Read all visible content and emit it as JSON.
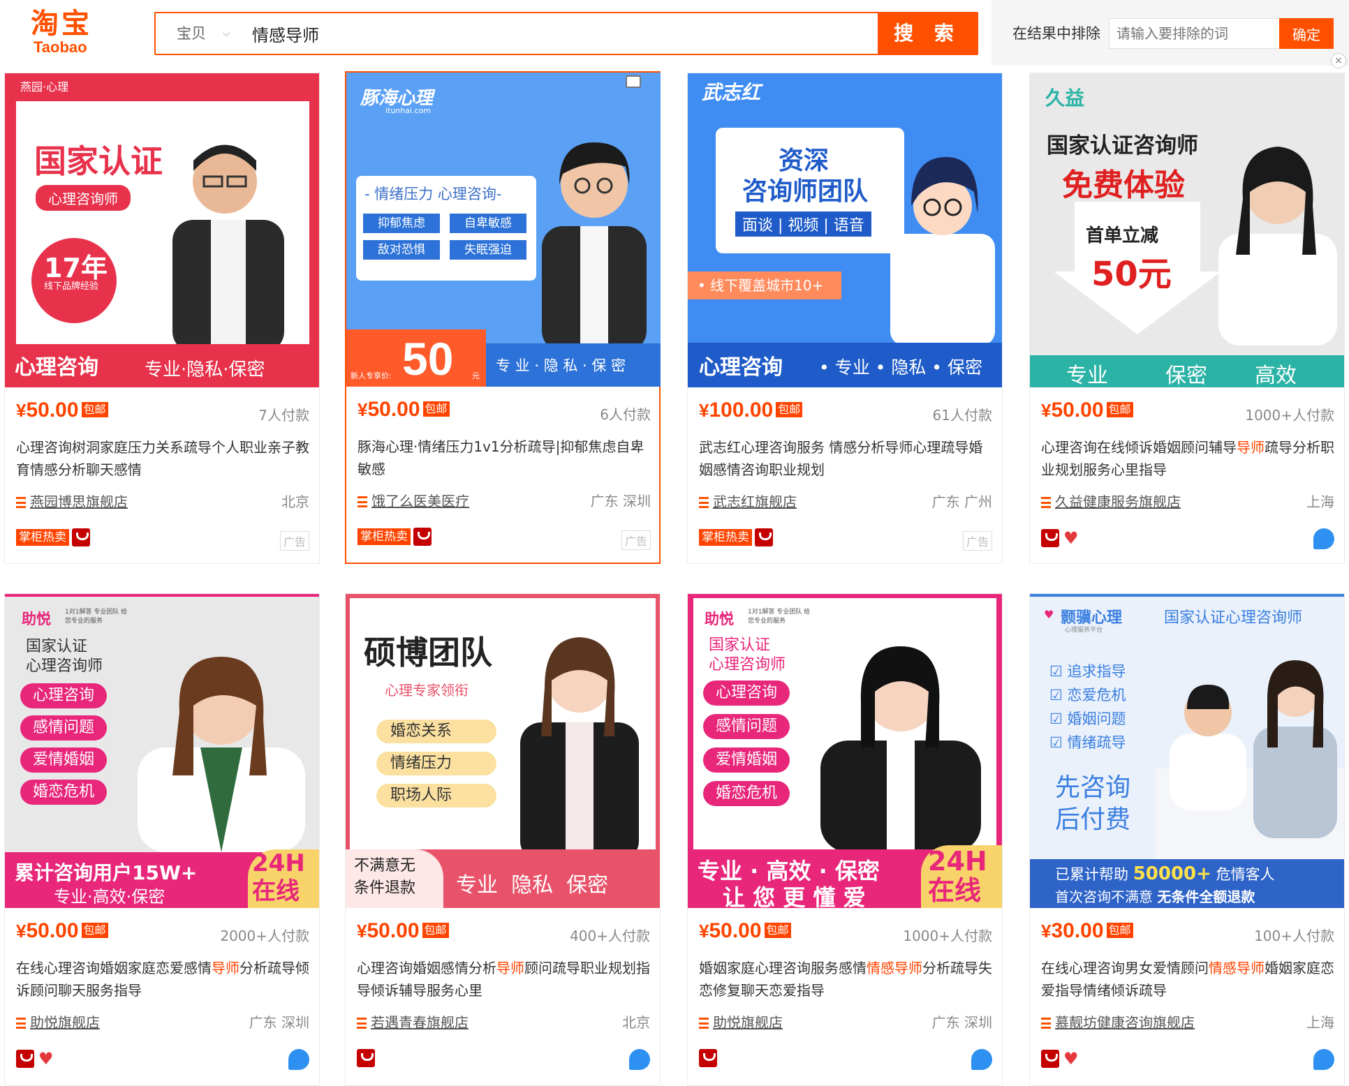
{
  "header": {
    "logo_cn": "淘宝",
    "logo_en": "Taobao",
    "scope": "宝贝",
    "query": "情感导师",
    "search_label": "搜 索",
    "exclude_label": "在结果中排除",
    "exclude_placeholder": "请输入要排除的词",
    "confirm_label": "确定",
    "close_symbol": "×"
  },
  "products": [
    {
      "price": "50.00",
      "baoyou": "包邮",
      "sales": "7人付款",
      "title": "心理咨询树洞家庭压力关系疏导个人职业亲子教育情感分析聊天感情",
      "shop": "燕园博思旗舰店",
      "location": "北京",
      "hot": "掌柜热卖",
      "ad": "广告",
      "img": {
        "brand": "燕园·心理",
        "headline": "国家认证",
        "sub": "心理咨询师",
        "years": "17年",
        "years_note": "线下品牌经验",
        "banner_left": "心理咨询",
        "banner_right": "专业·隐私·保密"
      }
    },
    {
      "price": "50.00",
      "baoyou": "包邮",
      "sales": "6人付款",
      "title": "豚海心理·情绪压力1v1分析疏导|抑郁焦虑自卑敏感",
      "shop": "饿了么医美医疗",
      "location": "广东 深圳",
      "hot": "掌柜热卖",
      "ad": "广告",
      "img": {
        "brand": "豚海心理",
        "brand_url": "itunhai.com",
        "panel_title": "- 情绪压力 心理咨询-",
        "tags": [
          "抑郁焦虑",
          "自卑敏感",
          "敌对恐惧",
          "失眠强迫"
        ],
        "new_label": "新人专享价:",
        "big_price": "50",
        "unit": "元",
        "banner_right": "专 业 · 隐 私 · 保 密"
      }
    },
    {
      "price": "100.00",
      "baoyou": "包邮",
      "sales": "61人付款",
      "title": "武志红心理咨询服务 情感分析导师心理疏导婚姻感情咨询职业规划",
      "shop": "武志红旗舰店",
      "location": "广东 广州",
      "hot": "掌柜热卖",
      "ad": "广告",
      "img": {
        "brand": "武志红",
        "headline1": "资深",
        "headline2": "咨询师团队",
        "modes": "面谈 | 视频 | 语音",
        "city": "• 线下覆盖城市10+",
        "banner_left": "心理咨询",
        "banner_right": "• 专业 • 隐私 • 保密"
      }
    },
    {
      "price": "50.00",
      "baoyou": "包邮",
      "sales": "1000+人付款",
      "title_a": "心理咨询在线倾诉婚姻顾问辅导",
      "title_hl": "导师",
      "title_b": "疏导分析职业规划服务心里指导",
      "shop": "久益健康服务旗舰店",
      "location": "上海",
      "img": {
        "brand": "久益",
        "line1": "国家认证咨询师",
        "line2": "免费体验",
        "arrow1": "首单立减",
        "arrow2": "50元",
        "banner": [
          "专业",
          "保密",
          "高效"
        ]
      }
    },
    {
      "price": "50.00",
      "baoyou": "包邮",
      "sales": "2000+人付款",
      "title_a": "在线心理咨询婚姻家庭恋爱感情",
      "title_hl": "导师",
      "title_b": "分析疏导倾诉顾问聊天服务指导",
      "shop": "助悦旗舰店",
      "location": "广东 深圳",
      "img": {
        "brand": "助悦",
        "brand_note": "1对1解答 专业团队 给您专业的服务",
        "cert": "国家认证\n心理咨询师",
        "tags": [
          "心理咨询",
          "感情问题",
          "爱情婚姻",
          "婚恋危机"
        ],
        "banner1": "累计咨询用户15W+",
        "banner2": "专业·高效·保密",
        "online": "24H\n在线"
      }
    },
    {
      "price": "50.00",
      "baoyou": "包邮",
      "sales": "400+人付款",
      "title_a": "心理咨询婚姻感情分析",
      "title_hl": "导师",
      "title_b": "顾问疏导职业规划指导倾诉辅导服务心里",
      "shop": "若遇青春旗舰店",
      "location": "北京",
      "img": {
        "headline": "硕博团队",
        "sub": "心理专家领衔",
        "tags": [
          "婚恋关系",
          "情绪压力",
          "职场人际"
        ],
        "refund": "不满意无\n条件退款",
        "banner": "专业  隐私  保密"
      }
    },
    {
      "price": "50.00",
      "baoyou": "包邮",
      "sales": "1000+人付款",
      "title_a": "婚姻家庭心理咨询服务感情",
      "title_hl": "情感导师",
      "title_b": "分析疏导失恋修复聊天恋爱指导",
      "shop": "助悦旗舰店",
      "location": "广东 深圳",
      "img": {
        "brand": "助悦",
        "brand_note": "1对1解答 专业团队 给您专业的服务",
        "cert": "国家认证\n心理咨询师",
        "tags": [
          "心理咨询",
          "感情问题",
          "爱情婚姻",
          "婚恋危机"
        ],
        "banner1": "专业 · 高效 · 保密",
        "banner2": "让 您 更 懂 爱",
        "online": "24H\n在线"
      }
    },
    {
      "price": "30.00",
      "baoyou": "包邮",
      "sales": "100+人付款",
      "title_a": "在线心理咨询男女爱情顾问",
      "title_hl": "情感导师",
      "title_b": "婚姻家庭恋爱指导情绪倾诉疏导",
      "shop": "慕靓坊健康咨询旗舰店",
      "location": "上海",
      "img": {
        "brand": "颢骥心理",
        "brand_note": "心理服务平台",
        "cert": "国家认证心理咨询师",
        "checks": [
          "追求指导",
          "恋爱危机",
          "婚姻问题",
          "情绪疏导"
        ],
        "big1": "先咨询",
        "big2": "后付费",
        "stat_a": "已累计帮助",
        "stat_num": "50000+",
        "stat_b": "危情客人",
        "refund_a": "首次咨询不满意",
        "refund_b": "无条件全额退款"
      }
    }
  ]
}
